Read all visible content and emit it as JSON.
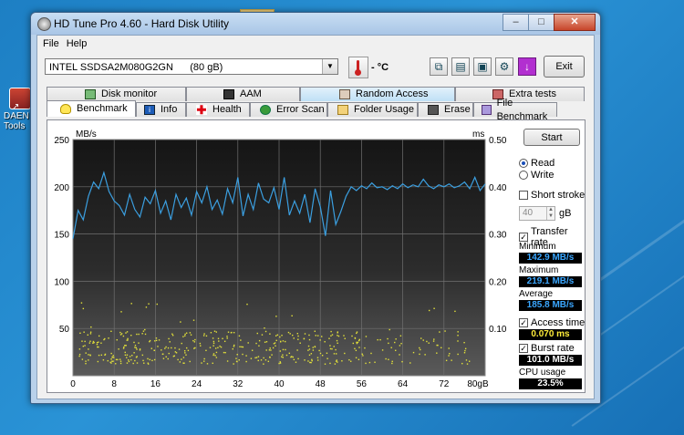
{
  "desktop": {
    "icon_label": "DAEN\nTools"
  },
  "window": {
    "title": "HD Tune Pro 4.60 - Hard Disk Utility",
    "buttons": {
      "minimize": "–",
      "maximize": "□",
      "close": "✕"
    }
  },
  "menu": {
    "file": "File",
    "help": "Help"
  },
  "toolbar": {
    "drive": "INTEL SSDSA2M080G2GN      (80 gB)",
    "temperature": "- °C",
    "exit": "Exit"
  },
  "tabs": {
    "row1": [
      "Disk monitor",
      "AAM",
      "Random Access",
      "Extra tests"
    ],
    "row2": [
      "Benchmark",
      "Info",
      "Health",
      "Error Scan",
      "Folder Usage",
      "Erase",
      "File Benchmark"
    ],
    "active": "Benchmark"
  },
  "benchmark": {
    "start": "Start",
    "read": "Read",
    "write": "Write",
    "short_stroke": "Short stroke",
    "short_stroke_value": "40",
    "short_stroke_unit": "gB",
    "transfer_rate": "Transfer rate",
    "minimum_label": "Minimum",
    "minimum_value": "142.9 MB/s",
    "maximum_label": "Maximum",
    "maximum_value": "219.1 MB/s",
    "average_label": "Average",
    "average_value": "185.8 MB/s",
    "access_time": "Access time",
    "access_time_value": "0.070 ms",
    "burst_rate": "Burst rate",
    "burst_rate_value": "101.0 MB/s",
    "cpu_usage": "CPU usage",
    "cpu_usage_value": "23.5%"
  },
  "chart_data": {
    "type": "line",
    "left_unit": "MB/s",
    "right_unit": "ms",
    "x_unit": "gB",
    "x_ticks": [
      "0",
      "8",
      "16",
      "24",
      "32",
      "40",
      "48",
      "56",
      "64",
      "72",
      "80gB"
    ],
    "y_left_ticks": [
      "250",
      "200",
      "150",
      "100",
      "50"
    ],
    "y_right_ticks": [
      "0.50",
      "0.40",
      "0.30",
      "0.20",
      "0.10"
    ],
    "xlim": [
      0,
      80
    ],
    "ylim_left": [
      0,
      250
    ],
    "ylim_right": [
      0,
      0.5
    ],
    "series": [
      {
        "color": "#3b9fe0",
        "x": [
          0,
          1,
          2,
          3,
          4,
          5,
          6,
          7,
          8,
          9,
          10,
          11,
          12,
          13,
          14,
          15,
          16,
          17,
          18,
          19,
          20,
          21,
          22,
          23,
          24,
          25,
          26,
          27,
          28,
          29,
          30,
          31,
          32,
          33,
          34,
          35,
          36,
          37,
          38,
          39,
          40,
          41,
          42,
          43,
          44,
          45,
          46,
          47,
          48,
          49,
          50,
          51,
          52,
          53,
          54,
          55,
          56,
          57,
          58,
          59,
          60,
          61,
          62,
          63,
          64,
          65,
          66,
          67,
          68,
          69,
          70,
          71,
          72,
          73,
          74,
          75,
          76,
          77,
          78,
          79,
          80
        ],
        "values": [
          145,
          175,
          165,
          190,
          205,
          198,
          215,
          195,
          185,
          180,
          170,
          192,
          176,
          168,
          189,
          182,
          196,
          172,
          185,
          165,
          192,
          178,
          188,
          170,
          195,
          183,
          200,
          176,
          186,
          171,
          198,
          183,
          210,
          169,
          192,
          176,
          204,
          187,
          183,
          199,
          176,
          210,
          170,
          185,
          172,
          192,
          162,
          198,
          179,
          148,
          196,
          160,
          174,
          190,
          200,
          196,
          201,
          198,
          204,
          199,
          200,
          197,
          201,
          198,
          203,
          199,
          202,
          200,
          208,
          201,
          198,
          202,
          200,
          203,
          199,
          201,
          205,
          198,
          210,
          196,
          203
        ]
      }
    ],
    "access_scatter_note_ms_range": [
      0.03,
      0.11
    ]
  }
}
